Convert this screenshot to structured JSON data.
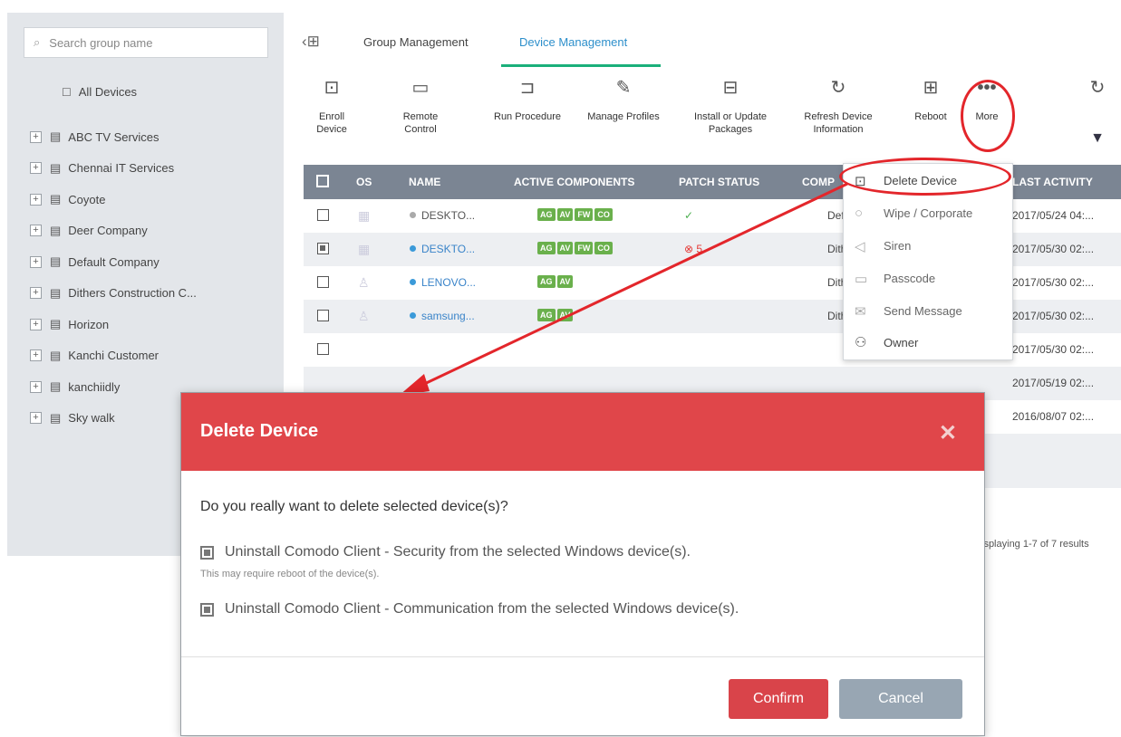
{
  "sidebar": {
    "search_placeholder": "Search group name",
    "all_devices": "All Devices",
    "groups": [
      "ABC TV Services",
      "Chennai IT Services",
      "Coyote",
      "Deer Company",
      "Default Company",
      "Dithers Construction C...",
      "Horizon",
      "Kanchi Customer",
      "kanchiidly",
      "Sky walk"
    ]
  },
  "tabs": {
    "group": "Group Management",
    "device": "Device Management"
  },
  "toolbar": {
    "enroll": "Enroll Device",
    "remote": "Remote Control",
    "run_procedure": "Run Procedure",
    "manage_profiles": "Manage Profiles",
    "install_1": "Install or Update",
    "install_2": "Packages",
    "refresh_1": "Refresh Device",
    "refresh_2": "Information",
    "reboot": "Reboot",
    "more": "More"
  },
  "grid": {
    "headers": {
      "os": "OS",
      "name": "NAME",
      "active": "ACTIVE COMPONENTS",
      "patch": "PATCH STATUS",
      "comp": "COMP",
      "activity": "LAST ACTIVITY"
    },
    "rows": [
      {
        "name": "DESKTO...",
        "badges": [
          "AG",
          "AV",
          "FW",
          "CO"
        ],
        "patch": "✓",
        "comp": "Default",
        "activity": "2017/05/24 04:..."
      },
      {
        "name": "DESKTO...",
        "badges": [
          "AG",
          "AV",
          "FW",
          "CO"
        ],
        "patch": "⊗ 5",
        "comp": "Dithers",
        "activity": "2017/05/30 02:..."
      },
      {
        "name": "LENOVO...",
        "badges": [
          "AG",
          "AV"
        ],
        "patch": "",
        "comp": "Dithers",
        "activity": "2017/05/30 02:..."
      },
      {
        "name": "samsung...",
        "badges": [
          "AG",
          "AV"
        ],
        "patch": "",
        "comp": "Dithers",
        "activity": "2017/05/30 02:..."
      },
      {
        "name": "",
        "badges": [],
        "patch": "",
        "comp": "",
        "activity": "2017/05/30 02:..."
      },
      {
        "name": "",
        "badges": [],
        "patch": "",
        "comp": "",
        "activity": "2017/05/19 02:..."
      },
      {
        "name": "",
        "badges": [],
        "patch": "",
        "comp": "",
        "activity": "2016/08/07 02:..."
      }
    ],
    "pager": "isplaying 1-7 of 7 results"
  },
  "more_menu": {
    "delete": "Delete Device",
    "wipe": "Wipe / Corporate",
    "siren": "Siren",
    "passcode": "Passcode",
    "send_message": "Send Message",
    "owner": "Owner"
  },
  "modal": {
    "title": "Delete Device",
    "question": "Do you really want to delete selected device(s)?",
    "option1": "Uninstall Comodo Client - Security from the selected Windows device(s).",
    "option1_note": "This may require reboot of the device(s).",
    "option2": "Uninstall Comodo Client - Communication from the selected Windows device(s).",
    "confirm": "Confirm",
    "cancel": "Cancel"
  }
}
